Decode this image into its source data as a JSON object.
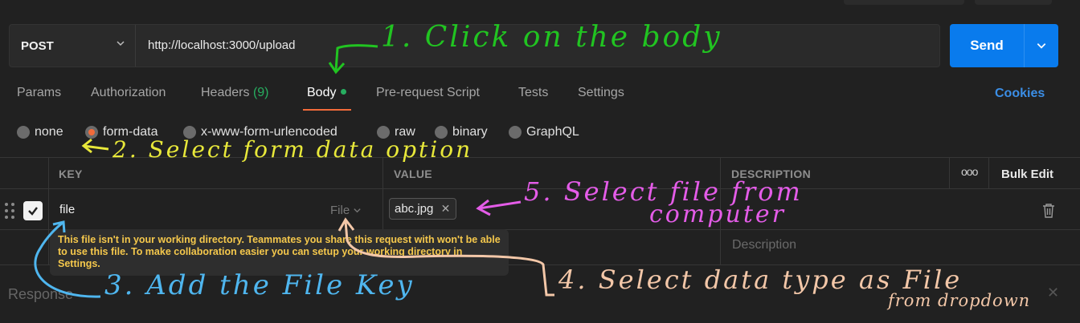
{
  "request": {
    "method": "POST",
    "url": "http://localhost:3000/upload",
    "send_label": "Send"
  },
  "tabs": [
    {
      "label": "Params",
      "count": ""
    },
    {
      "label": "Authorization",
      "count": ""
    },
    {
      "label": "Headers",
      "count": "(9)"
    },
    {
      "label": "Body",
      "count": "",
      "active": true
    },
    {
      "label": "Pre-request Script",
      "count": ""
    },
    {
      "label": "Tests",
      "count": ""
    },
    {
      "label": "Settings",
      "count": ""
    }
  ],
  "cookies_label": "Cookies",
  "body_modes": [
    "none",
    "form-data",
    "x-www-form-urlencoded",
    "raw",
    "binary",
    "GraphQL"
  ],
  "selected_body_mode": "form-data",
  "table": {
    "headers": {
      "key": "KEY",
      "value": "VALUE",
      "description": "DESCRIPTION"
    },
    "more_label": "ooo",
    "bulk_edit_label": "Bulk Edit",
    "row": {
      "key": "file",
      "type": "File",
      "file_name": "abc.jpg",
      "description_placeholder": "Description"
    }
  },
  "tooltip": "This file isn't in your working directory. Teammates you share this request with won't be able to use this file. To make collaboration easier you can setup your working directory in Settings.",
  "response_label": "Response",
  "annotations": {
    "step1": "1. Click on the body",
    "step2": "2. Select form data option",
    "step3": "3. Add the File Key",
    "step4_line1": "4. Select data type as File",
    "step4_line2": "from dropdown",
    "step5_line1": "5. Select file from",
    "step5_line2": "computer"
  },
  "colors": {
    "accent_send": "#097bed",
    "active_tab_underline": "#f26b3a",
    "cookies_link": "#3b8ee6",
    "tooltip_text": "#f5c84c",
    "anno_green": "#21c421",
    "anno_yellow": "#e8e83a",
    "anno_pink": "#e45ce8",
    "anno_blue": "#4fb6ef",
    "anno_peach": "#f3c7a8"
  }
}
